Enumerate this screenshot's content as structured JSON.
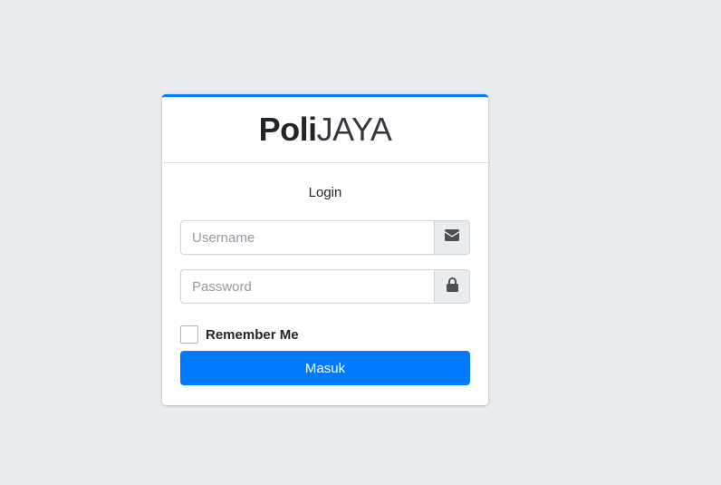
{
  "brand": {
    "bold": "Poli",
    "light": "JAYA"
  },
  "login_message": "Login",
  "username": {
    "placeholder": "Username",
    "value": "",
    "icon": "envelope-icon"
  },
  "password": {
    "placeholder": "Password",
    "value": "",
    "icon": "lock-icon"
  },
  "remember": {
    "label": "Remember Me",
    "checked": false
  },
  "submit_label": "Masuk",
  "colors": {
    "accent": "#007bff",
    "background": "#e9ecef",
    "addon": "#e9ecef",
    "icon": "#495057"
  }
}
